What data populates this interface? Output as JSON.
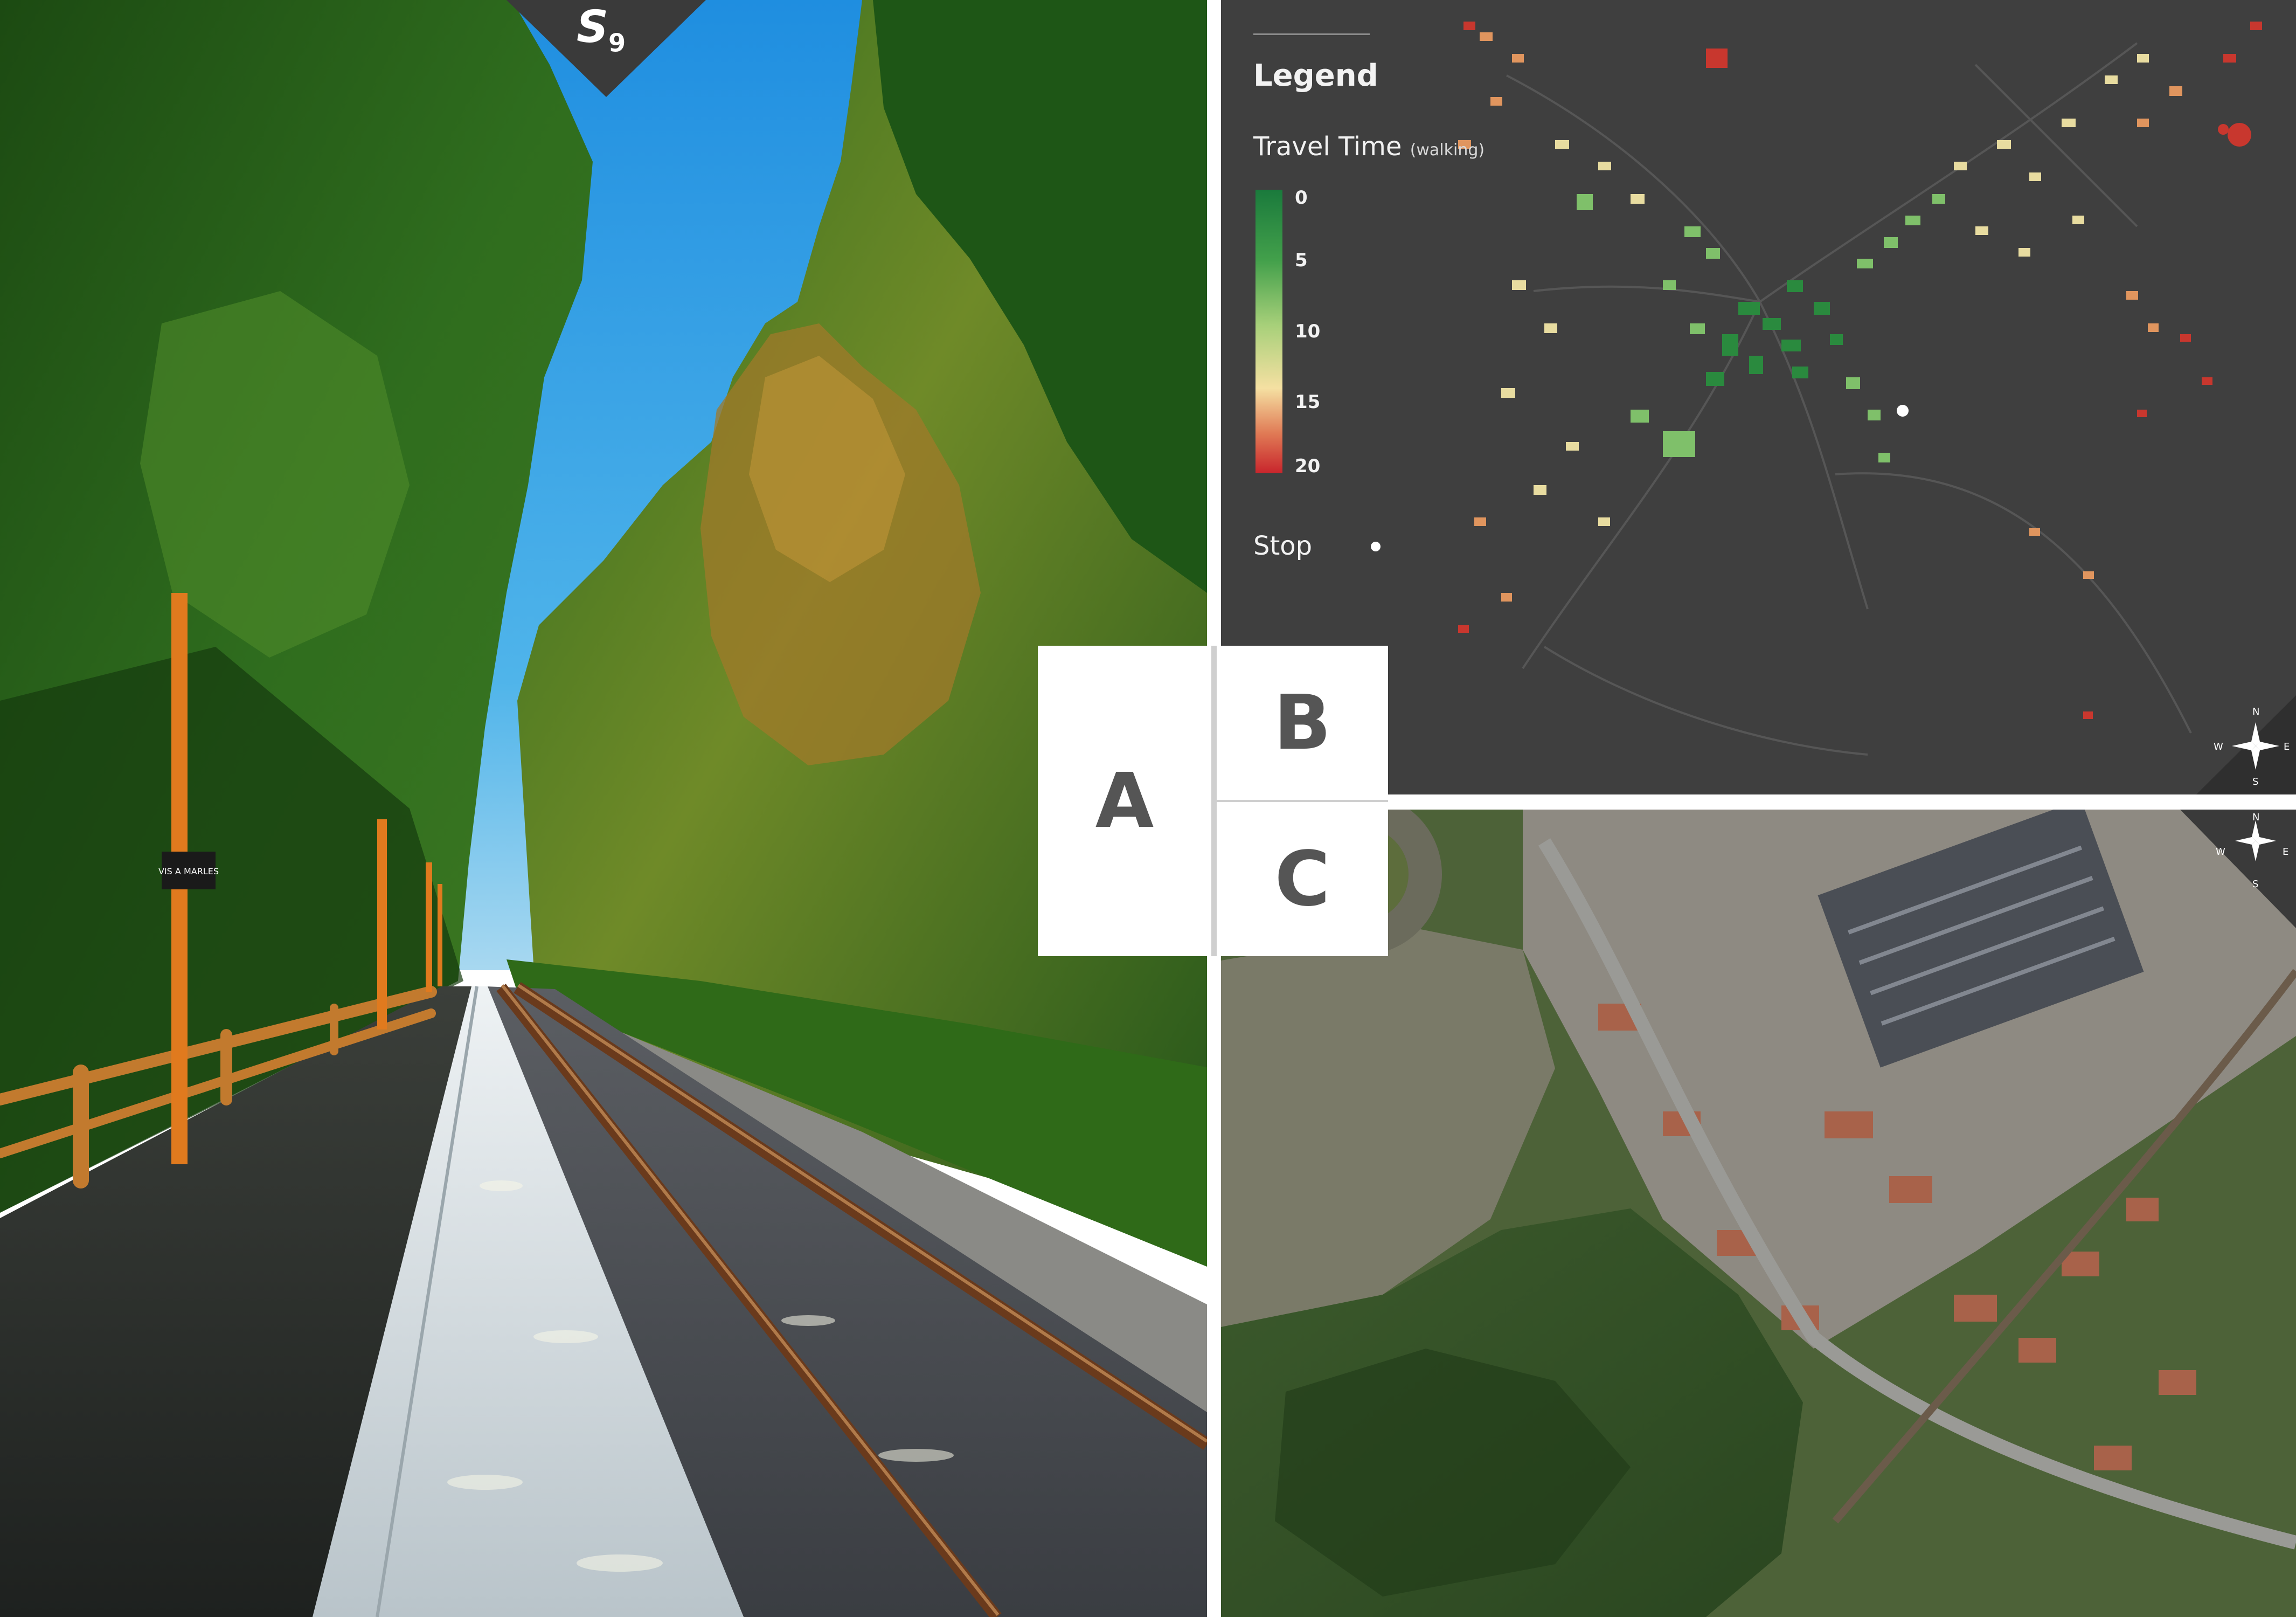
{
  "series_badge": {
    "letter": "S",
    "index": "9"
  },
  "panel_a": {
    "station_sign": "VIS A MARLES"
  },
  "panel_labels": {
    "a": "A",
    "b": "B",
    "c": "C"
  },
  "legend": {
    "title": "Legend",
    "measure": "Travel Time",
    "measure_note": "(walking)",
    "ramp_ticks": [
      "0",
      "5",
      "10",
      "15",
      "20"
    ],
    "ramp_colors": [
      "#1a7a3c",
      "#43a04b",
      "#a8d07a",
      "#f5e0a2",
      "#e07a55",
      "#c8252c"
    ],
    "stop_label": "Stop"
  },
  "compass": {
    "n": "N",
    "s": "S",
    "e": "E",
    "w": "W"
  },
  "colors": {
    "map_background": "#3f3f3f",
    "sky": "#2e9be0",
    "foliage": "#2d6a1e",
    "platform": "#d8dde0",
    "rail": "#7a4a2a",
    "pole": "#e07a1e"
  }
}
